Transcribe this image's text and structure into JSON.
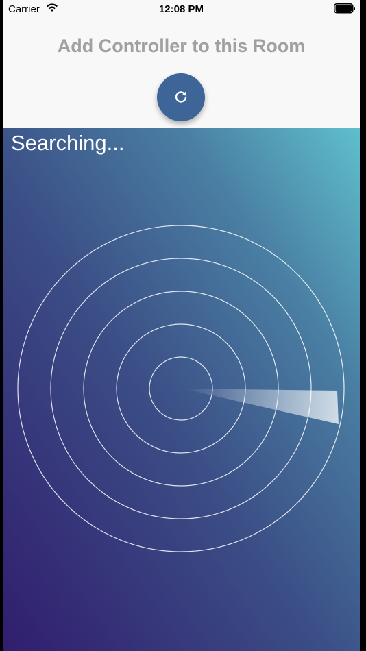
{
  "status_bar": {
    "carrier": "Carrier",
    "time": "12:08 PM"
  },
  "header": {
    "title": "Add Controller to this Room"
  },
  "radar": {
    "status_text": "Searching..."
  },
  "icons": {
    "wifi": "wifi-icon",
    "battery": "battery-icon",
    "refresh": "refresh-icon"
  },
  "colors": {
    "accent": "#3d6597",
    "title_gray": "#a0a0a0",
    "gradient_dark": "#311d6e",
    "gradient_light": "#5fbfcc"
  }
}
